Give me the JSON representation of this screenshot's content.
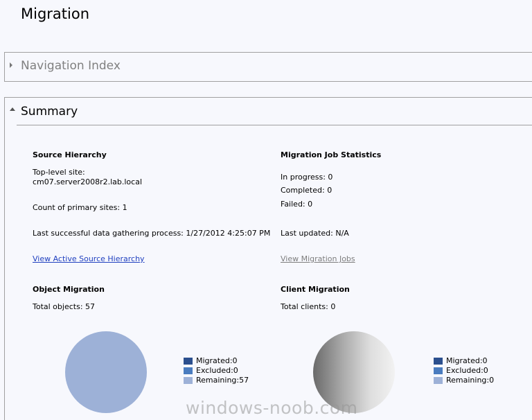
{
  "page": {
    "title": "Migration"
  },
  "navigation_index": {
    "label": "Navigation Index"
  },
  "summary": {
    "label": "Summary"
  },
  "source_hierarchy": {
    "heading": "Source Hierarchy",
    "top_level_label": "Top-level site:",
    "top_level_value": "cm07.server2008r2.lab.local",
    "primary_sites": "Count of primary sites: 1",
    "last_gathering": "Last successful data gathering process: 1/27/2012 4:25:07 PM",
    "link": "View Active Source Hierarchy"
  },
  "job_stats": {
    "heading": "Migration Job Statistics",
    "in_progress": "In progress: 0",
    "completed": "Completed: 0",
    "failed": "Failed: 0",
    "last_updated": "Last updated: N/A",
    "link": "View Migration Jobs"
  },
  "object_migration": {
    "heading": "Object Migration",
    "total": "Total objects: 57",
    "legend": [
      {
        "label": "Migrated:0",
        "color": "#2b4f8e"
      },
      {
        "label": "Excluded:0",
        "color": "#4a7cbf"
      },
      {
        "label": "Remaining:57",
        "color": "#9db1d7"
      }
    ]
  },
  "client_migration": {
    "heading": "Client Migration",
    "total": "Total clients: 0",
    "legend": [
      {
        "label": "Migrated:0",
        "color": "#2b4f8e"
      },
      {
        "label": "Excluded:0",
        "color": "#4a7cbf"
      },
      {
        "label": "Remaining:0",
        "color": "#9db1d7"
      }
    ]
  },
  "watermark": "windows-noob.com"
}
